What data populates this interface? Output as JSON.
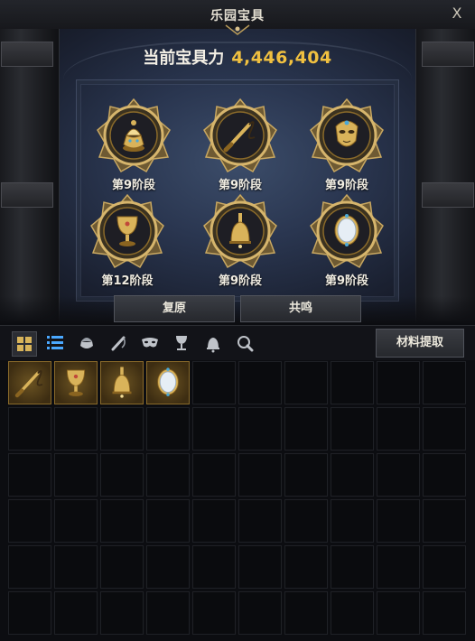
{
  "window": {
    "title": "乐园宝具",
    "close_label": "X"
  },
  "power": {
    "label": "当前宝具力",
    "value": "4,446,404"
  },
  "treasures": [
    {
      "icon": "incense-burner-icon",
      "stage": "第9阶段"
    },
    {
      "icon": "whip-icon",
      "stage": "第9阶段"
    },
    {
      "icon": "golden-mask-icon",
      "stage": "第9阶段"
    },
    {
      "icon": "goblet-icon",
      "stage": "第12阶段"
    },
    {
      "icon": "bell-icon",
      "stage": "第9阶段"
    },
    {
      "icon": "mirror-icon",
      "stage": "第9阶段"
    }
  ],
  "buttons": {
    "restore": "复原",
    "resonate": "共鸣",
    "extract": "材料提取"
  },
  "toolbar": {
    "items": [
      {
        "icon": "grid-view-icon",
        "active": true
      },
      {
        "icon": "list-view-icon",
        "active": false
      },
      {
        "icon": "incense-burner-filter-icon",
        "active": false
      },
      {
        "icon": "whip-filter-icon",
        "active": false
      },
      {
        "icon": "mask-filter-icon",
        "active": false
      },
      {
        "icon": "goblet-filter-icon",
        "active": false
      },
      {
        "icon": "bell-filter-icon",
        "active": false
      },
      {
        "icon": "mirror-filter-icon",
        "active": false
      }
    ]
  },
  "inventory": {
    "columns": 10,
    "rows": 6,
    "items": [
      {
        "slot": 1,
        "icon": "whip-icon"
      },
      {
        "slot": 2,
        "icon": "goblet-icon"
      },
      {
        "slot": 3,
        "icon": "bell-icon"
      },
      {
        "slot": 4,
        "icon": "mirror-icon"
      }
    ]
  },
  "colors": {
    "power_value": "#f0c040",
    "gold": "#c9a24a",
    "background": "#0c0d11"
  }
}
